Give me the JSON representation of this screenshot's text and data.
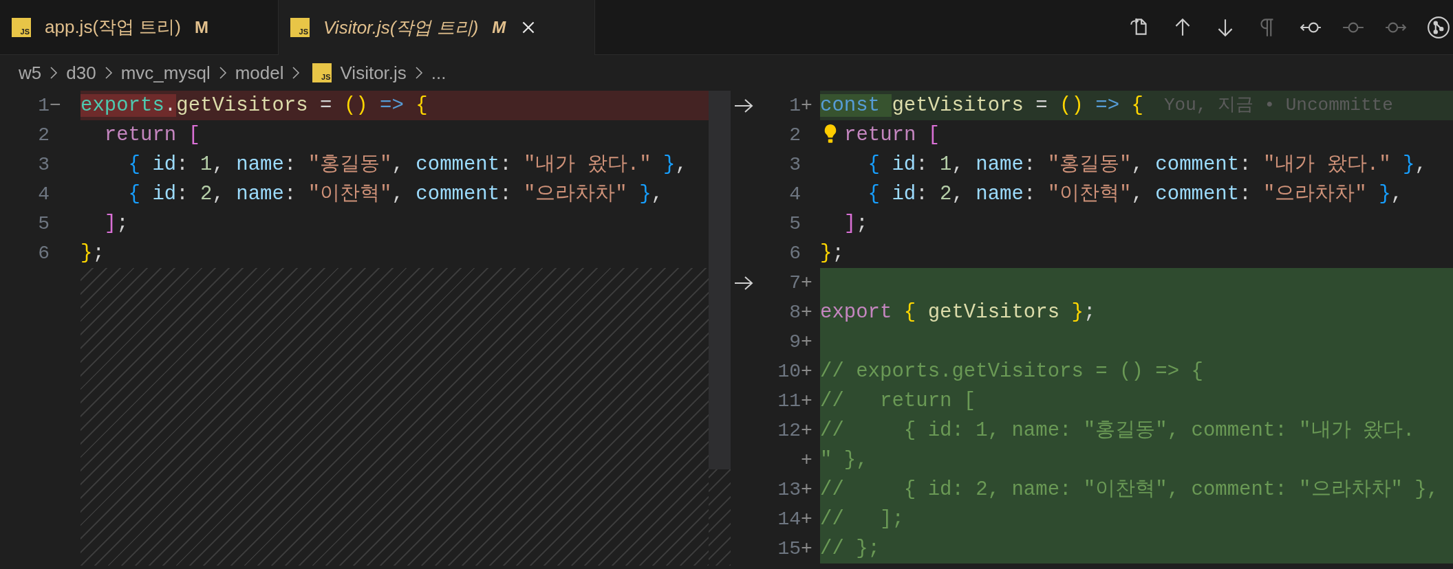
{
  "tabs": [
    {
      "icon": "JS",
      "label": "app.js(작업 트리)",
      "badge": "M",
      "selected": false,
      "preview": false
    },
    {
      "icon": "JS",
      "label": "Visitor.js(작업 트리)",
      "badge": "M",
      "selected": true,
      "preview": true
    }
  ],
  "toolbar": [
    {
      "kind": "open-file",
      "disabled": false
    },
    {
      "kind": "up",
      "disabled": false
    },
    {
      "kind": "down",
      "disabled": false
    },
    {
      "kind": "whitespace",
      "disabled": true
    },
    {
      "kind": "revert-left",
      "disabled": false
    },
    {
      "kind": "stage",
      "disabled": true
    },
    {
      "kind": "revert-right",
      "disabled": true
    },
    {
      "kind": "compare",
      "disabled": false
    }
  ],
  "breadcrumb": [
    {
      "label": "w5"
    },
    {
      "label": "d30"
    },
    {
      "label": "mvc_mysql"
    },
    {
      "label": "model"
    },
    {
      "label": "Visitor.js",
      "icon": "JS"
    },
    {
      "label": "..."
    }
  ],
  "left_lines": [
    {
      "number": "1",
      "marker": "−",
      "kind": "removed",
      "tokens": [
        {
          "kind": "variable",
          "text": "exports",
          "changed": true
        },
        {
          "kind": "plain",
          "text": ".",
          "changed": true
        },
        {
          "kind": "func",
          "text": "getVisitors"
        },
        {
          "kind": "plain",
          "text": " = "
        },
        {
          "kind": "paren",
          "text": "()"
        },
        {
          "kind": "storage",
          "text": " =>"
        },
        {
          "kind": "paren",
          "text": " {"
        }
      ]
    },
    {
      "number": "2",
      "kind": "unchanged",
      "tokens": [
        {
          "kind": "control",
          "text": "  return"
        },
        {
          "kind": "bracket",
          "text": " ["
        }
      ]
    },
    {
      "number": "3",
      "kind": "unchanged",
      "tokens": [
        {
          "kind": "brace",
          "text": "    {"
        },
        {
          "kind": "prop",
          "text": " id"
        },
        {
          "kind": "plain",
          "text": ": "
        },
        {
          "kind": "num",
          "text": "1"
        },
        {
          "kind": "plain",
          "text": ", "
        },
        {
          "kind": "prop",
          "text": "name"
        },
        {
          "kind": "plain",
          "text": ": "
        },
        {
          "kind": "str",
          "text": "\"홍길동\""
        },
        {
          "kind": "plain",
          "text": ", "
        },
        {
          "kind": "prop",
          "text": "comment"
        },
        {
          "kind": "plain",
          "text": ": "
        },
        {
          "kind": "str",
          "text": "\"내가 왔다.\""
        },
        {
          "kind": "brace",
          "text": " }"
        },
        {
          "kind": "plain",
          "text": ","
        }
      ]
    },
    {
      "number": "4",
      "kind": "unchanged",
      "tokens": [
        {
          "kind": "brace",
          "text": "    {"
        },
        {
          "kind": "prop",
          "text": " id"
        },
        {
          "kind": "plain",
          "text": ": "
        },
        {
          "kind": "num",
          "text": "2"
        },
        {
          "kind": "plain",
          "text": ", "
        },
        {
          "kind": "prop",
          "text": "name"
        },
        {
          "kind": "plain",
          "text": ": "
        },
        {
          "kind": "str",
          "text": "\"이찬혁\""
        },
        {
          "kind": "plain",
          "text": ", "
        },
        {
          "kind": "prop",
          "text": "comment"
        },
        {
          "kind": "plain",
          "text": ": "
        },
        {
          "kind": "str",
          "text": "\"으라차차\""
        },
        {
          "kind": "brace",
          "text": " }"
        },
        {
          "kind": "plain",
          "text": ","
        }
      ]
    },
    {
      "number": "5",
      "kind": "unchanged",
      "tokens": [
        {
          "kind": "bracket",
          "text": "  ]"
        },
        {
          "kind": "plain",
          "text": ";"
        }
      ]
    },
    {
      "number": "6",
      "kind": "unchanged",
      "tokens": [
        {
          "kind": "paren",
          "text": "}"
        },
        {
          "kind": "plain",
          "text": ";"
        }
      ]
    }
  ],
  "right_lines": [
    {
      "number": "1",
      "marker": "+",
      "kind": "added",
      "arrow": true,
      "blame": "You, 지금 • Uncommitte",
      "tokens": [
        {
          "kind": "storage",
          "text": "const ",
          "changed": true
        },
        {
          "kind": "func",
          "text": "getVisitors"
        },
        {
          "kind": "plain",
          "text": " = "
        },
        {
          "kind": "paren",
          "text": "()"
        },
        {
          "kind": "storage",
          "text": " =>"
        },
        {
          "kind": "paren",
          "text": " {"
        }
      ]
    },
    {
      "number": "2",
      "kind": "unchanged",
      "lightbulb": true,
      "tokens": [
        {
          "kind": "control",
          "text": "return"
        },
        {
          "kind": "bracket",
          "text": " ["
        }
      ]
    },
    {
      "number": "3",
      "kind": "unchanged",
      "tokens": [
        {
          "kind": "brace",
          "text": "    {"
        },
        {
          "kind": "prop",
          "text": " id"
        },
        {
          "kind": "plain",
          "text": ": "
        },
        {
          "kind": "num",
          "text": "1"
        },
        {
          "kind": "plain",
          "text": ", "
        },
        {
          "kind": "prop",
          "text": "name"
        },
        {
          "kind": "plain",
          "text": ": "
        },
        {
          "kind": "str",
          "text": "\"홍길동\""
        },
        {
          "kind": "plain",
          "text": ", "
        },
        {
          "kind": "prop",
          "text": "comment"
        },
        {
          "kind": "plain",
          "text": ": "
        },
        {
          "kind": "str",
          "text": "\"내가 왔다.\""
        },
        {
          "kind": "brace",
          "text": " }"
        },
        {
          "kind": "plain",
          "text": ","
        }
      ]
    },
    {
      "number": "4",
      "kind": "unchanged",
      "tokens": [
        {
          "kind": "brace",
          "text": "    {"
        },
        {
          "kind": "prop",
          "text": " id"
        },
        {
          "kind": "plain",
          "text": ": "
        },
        {
          "kind": "num",
          "text": "2"
        },
        {
          "kind": "plain",
          "text": ", "
        },
        {
          "kind": "prop",
          "text": "name"
        },
        {
          "kind": "plain",
          "text": ": "
        },
        {
          "kind": "str",
          "text": "\"이찬혁\""
        },
        {
          "kind": "plain",
          "text": ", "
        },
        {
          "kind": "prop",
          "text": "comment"
        },
        {
          "kind": "plain",
          "text": ": "
        },
        {
          "kind": "str",
          "text": "\"으라차차\""
        },
        {
          "kind": "brace",
          "text": " }"
        },
        {
          "kind": "plain",
          "text": ","
        }
      ]
    },
    {
      "number": "5",
      "kind": "unchanged",
      "tokens": [
        {
          "kind": "bracket",
          "text": "  ]"
        },
        {
          "kind": "plain",
          "text": ";"
        }
      ]
    },
    {
      "number": "6",
      "kind": "unchanged",
      "tokens": [
        {
          "kind": "paren",
          "text": "}"
        },
        {
          "kind": "plain",
          "text": ";"
        }
      ]
    },
    {
      "number": "7",
      "marker": "+",
      "kind": "inserted",
      "arrow": true
    },
    {
      "number": "8",
      "marker": "+",
      "kind": "inserted",
      "tokens": [
        {
          "kind": "control",
          "text": "export"
        },
        {
          "kind": "paren",
          "text": " {"
        },
        {
          "kind": "func",
          "text": " getVisitors"
        },
        {
          "kind": "paren",
          "text": " }"
        },
        {
          "kind": "plain",
          "text": ";"
        }
      ]
    },
    {
      "number": "9",
      "marker": "+",
      "kind": "inserted"
    },
    {
      "number": "10",
      "marker": "+",
      "kind": "inserted",
      "tokens": [
        {
          "kind": "comment",
          "text": "// exports.getVisitors = () => {"
        }
      ]
    },
    {
      "number": "11",
      "marker": "+",
      "kind": "inserted",
      "tokens": [
        {
          "kind": "comment",
          "text": "//   return ["
        }
      ]
    },
    {
      "number": "12",
      "marker": "+",
      "kind": "inserted",
      "tokens": [
        {
          "kind": "comment",
          "text": "//     { id: 1, name: \"홍길동\", comment: \"내가 왔다."
        }
      ]
    },
    {
      "marker": "+",
      "kind": "inserted",
      "tokens": [
        {
          "kind": "comment",
          "text": "\" },"
        }
      ]
    },
    {
      "number": "13",
      "marker": "+",
      "kind": "inserted",
      "tokens": [
        {
          "kind": "comment",
          "text": "//     { id: 2, name: \"이찬혁\", comment: \"으라차차\" },"
        }
      ]
    },
    {
      "number": "14",
      "marker": "+",
      "kind": "inserted",
      "tokens": [
        {
          "kind": "comment",
          "text": "//   ];"
        }
      ]
    },
    {
      "number": "15",
      "marker": "+",
      "kind": "inserted",
      "tokens": [
        {
          "kind": "comment",
          "text": "// };"
        }
      ]
    }
  ]
}
